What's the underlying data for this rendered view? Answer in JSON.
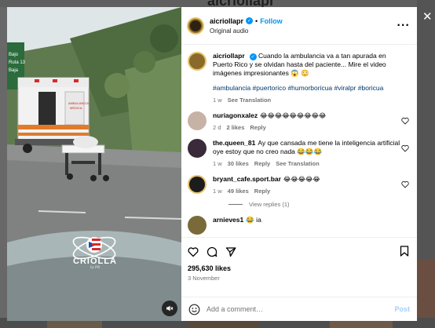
{
  "background": {
    "profile_title": "aicriollapr",
    "close_label": "✕"
  },
  "header": {
    "username": "aicriollapr",
    "verified_mark": "✓",
    "separator": "•",
    "follow_label": "Follow",
    "audio": "Original audio",
    "more_label": "···"
  },
  "caption": {
    "username": "aicriollapr",
    "text": "Cuando la ambulancia va a tan apurada en Puerto Rico y se olvidan hasta del paciente... Mire el video imágenes impresionantes 😱 😳",
    "hashtags": "#ambulancia #puertorico #humorboricua #viralpr #boricua",
    "age": "1 w",
    "see_translation": "See Translation"
  },
  "comments": [
    {
      "username": "nuriagonxalez",
      "text": "😂😂😂😂😂😂😂😂😂",
      "age": "2 d",
      "likes": "2 likes",
      "reply": "Reply",
      "avatar_color": "#c7b3a6"
    },
    {
      "username": "the.queen_81",
      "text": "Ay que cansada me tiene la inteligencia artificial oye estoy que no creo nada 😂😂😂",
      "age": "1 w",
      "likes": "30 likes",
      "reply": "Reply",
      "see_translation": "See Translation",
      "avatar_color": "#3a2a3a"
    },
    {
      "username": "bryant_cafe.sport.bar",
      "text": "😂😂😂😂😂",
      "age": "1 w",
      "likes": "49 likes",
      "reply": "Reply",
      "view_replies": "View replies (1)",
      "avatar_color": "#1c1c1c"
    },
    {
      "username": "arnieves1",
      "text": "😂 ia",
      "avatar_color": "#7a6a3a"
    }
  ],
  "actions": {
    "likes": "295,630 likes",
    "date": "3 November"
  },
  "add_comment": {
    "placeholder": "Add a comment…",
    "post_label": "Post"
  },
  "video": {
    "watermark": "CRIOLLA",
    "watermark_sub": "by PR",
    "sign_text_1": "Bajo",
    "sign_text_2": "Ruta 13",
    "sign_text_3": "Baja",
    "ambulance_label_1": "AMBULANCIA",
    "ambulance_label_2": "MÉDICA"
  },
  "colors": {
    "accent": "#0095f6",
    "post_disabled": "#a4cff8",
    "hashtag": "#00376b",
    "ambulance_stripe": "#e07b2a"
  }
}
